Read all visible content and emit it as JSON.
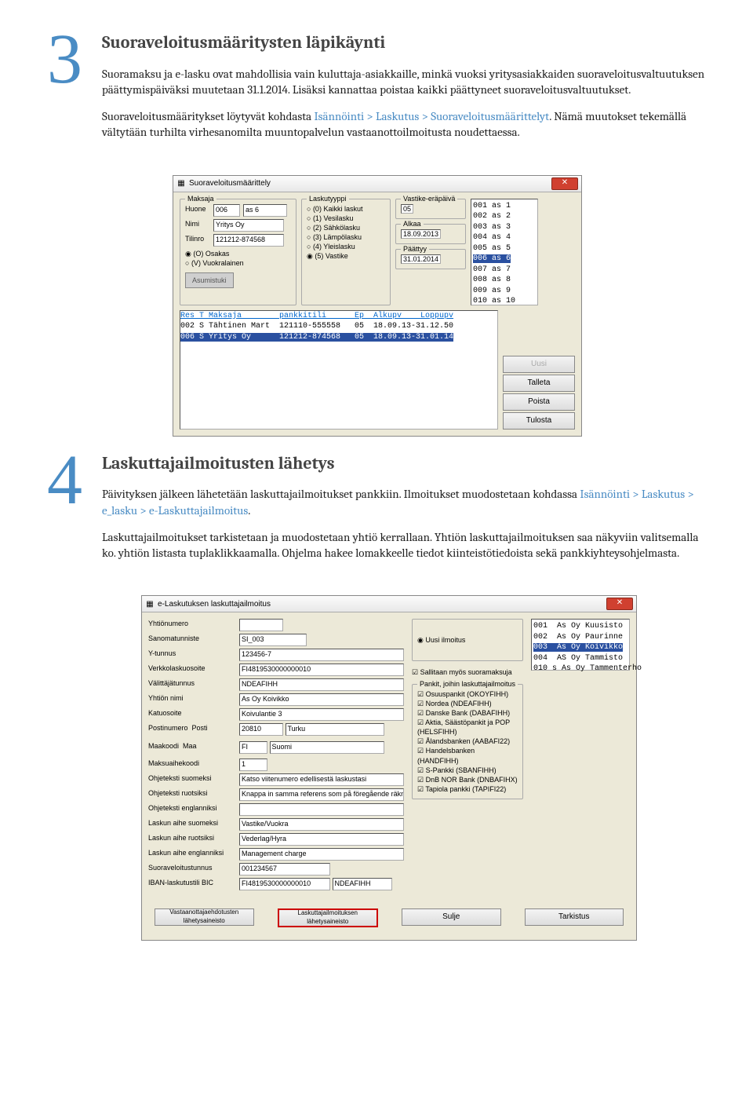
{
  "section3": {
    "num": "3",
    "title": "Suoraveloitusmääritysten läpikäynti",
    "para1": "Suoramaksu ja e-lasku ovat mahdollisia vain kuluttaja-asiakkaille, minkä vuoksi yritysasiakkaiden suoraveloitusvaltuutuksen päättymispäiväksi muutetaan 31.1.2014. Lisäksi kannattaa poistaa kaikki päättyneet suoraveloitusvaltuutukset.",
    "para2a": "Suoraveloitusmääritykset löytyvät kohdasta ",
    "para2link": "Isännöinti > Laskutus > Suoraveloitusmäärittelyt",
    "para2b": ". Nämä muutokset tekemällä vältytään turhilta virhesanomilta muuntopalvelun vastaanottoilmoitusta noudettaessa.",
    "win_title": "Suoraveloitusmäärittely",
    "left_labels": {
      "maksaja": "Maksaja",
      "huone": "Huone",
      "nimi": "Nimi",
      "tilinro": "Tilinro"
    },
    "left_vals": {
      "huone": "006",
      "huone_nimi": "as 6",
      "nimi": "Yritys Oy",
      "tilinro": "121212-874568"
    },
    "role_options": [
      "(O) Osakas",
      "(V) Vuokralainen"
    ],
    "role_selected": 0,
    "asumistuki_btn": "Asumistuki",
    "laskutyyppi_label": "Laskutyyppi",
    "laskutyypit": [
      "(0) Kaikki laskut",
      "(1) Vesilasku",
      "(2) Sähkölasku",
      "(3) Lämpölasku",
      "(4) Yleislasku",
      "(5) Vastike"
    ],
    "laskutyyppi_selected": 5,
    "mid_labels": {
      "era": "Vastike-eräpäivä",
      "alkaa": "Alkaa",
      "paattyy": "Päättyy"
    },
    "mid_vals": {
      "era": "05",
      "alkaa": "18.09.2013",
      "paattyy": "31.01.2014"
    },
    "side_list": [
      "001 as 1",
      "002 as 2",
      "003 as 3",
      "004 as 4",
      "005 as 5",
      "006 as 6",
      "007 as 7",
      "008 as 8",
      "009 as 9",
      "010 as 10"
    ],
    "side_selected_index": 5,
    "listing_header": "Res T Maksaja        pankkitili      Ep  Alkupv    Loppupv",
    "listing_rows": [
      "002 S Tähtinen Mart  121110-555558   05  18.09.13-31.12.50",
      "006 S Yritys Oy      121212-874568   05  18.09.13-31.01.14"
    ],
    "listing_selected_index": 1,
    "bottom_buttons": [
      "Uusi",
      "Talleta",
      "Poista",
      "Tulosta"
    ]
  },
  "section4": {
    "num": "4",
    "title": "Laskuttajailmoitusten lähetys",
    "para1a": "Päivityksen jälkeen lähetetään laskuttajailmoitukset pankkiin. Ilmoitukset muodostetaan kohdassa ",
    "para1link": "Isännöinti > Laskutus > e_lasku > e-Laskuttajailmoitus",
    "para1b": ".",
    "para2": "Laskuttajailmoitukset tarkistetaan ja muodostetaan yhtiö kerrallaan. Yhtiön laskuttajailmoituksen saa näkyviin valitsemalla ko. yhtiön listasta tuplaklikkaamalla. Ohjelma hakee lomakkeelle tiedot kiinteistötiedoista sekä pankkiyhteysohjelmasta.",
    "win_title": "e-Laskutuksen laskuttajailmoitus",
    "labels": {
      "yhtionumero": "Yhtiönumero",
      "sanomatunniste": "Sanomatunniste",
      "ytunnus": "Y-tunnus",
      "verkkolaskuosoite": "Verkkolaskuosoite",
      "valittajatunnus": "Välittäjätunnus",
      "yhtion_nimi": "Yhtiön nimi",
      "katuosoite": "Katuosoite",
      "postinumero": "Postinumero",
      "posti": "Posti",
      "maakoodi": "Maakoodi",
      "maa": "Maa",
      "maksuaihekoodi": "Maksuaihekoodi",
      "oht_fi": "Ohjeteksti suomeksi",
      "oht_sv": "Ohjeteksti ruotsiksi",
      "oht_en": "Ohjeteksti englanniksi",
      "aihe_fi": "Laskun aihe suomeksi",
      "aihe_sv": "Laskun aihe ruotsiksi",
      "aihe_en": "Laskun aihe englanniksi",
      "svtunnus": "Suoraveloitustunnus",
      "ibanbic": "IBAN-laskutustili   BIC"
    },
    "vals": {
      "yhtionumero": "",
      "sanomatunniste": "SI_003",
      "ytunnus": "123456-7",
      "verkkolaskuosoite": "FI4819530000000010",
      "valittajatunnus": "NDEAFIHH",
      "yhtion_nimi": "As Oy Koivikko",
      "katuosoite": "Koivulantie 3",
      "postinumero": "20810",
      "posti": "Turku",
      "maakoodi": "FI",
      "maa": "Suomi",
      "maksuaihekoodi": "1",
      "oht_fi": "Katso viitenumero edellisestä laskustasi",
      "oht_sv": "Knappa in samma referens som på föregående räkning",
      "oht_en": "",
      "aihe_fi": "Vastike/Vuokra",
      "aihe_sv": "Vederlag/Hyra",
      "aihe_en": "Management charge",
      "svtunnus": "001234567",
      "iban": "FI4819530000000010",
      "bic": "NDEAFIHH"
    },
    "ilmoitus_option": "Uusi ilmoitus",
    "sallitaan": "Sallitaan myös suoramaksuja",
    "pankit_label": "Pankit, joihin laskuttajailmoitus",
    "pankit": [
      "Osuuspankit (OKOYFIHH)",
      "Nordea (NDEAFIHH)",
      "Danske Bank (DABAFIHH)",
      "Aktia, Säästöpankit ja POP (HELSFIHH)",
      "Ålandsbanken (AABAFI22)",
      "Handelsbanken (HANDFIHH)",
      "S-Pankki (SBANFIHH)",
      "DnB NOR Bank (DNBAFIHX)",
      "Tapiola pankki   (TAPIFI22)"
    ],
    "side_list": [
      "001  As Oy Kuusisto",
      "002  As Oy Paurinne",
      "003  As Oy Koivikko",
      "004  AS Oy Tammisto",
      "010 s As Oy Tammenterho"
    ],
    "side_selected_index": 2,
    "footer": {
      "btn1": "Vastaanottajaehdotusten lähetysaineisto",
      "btn2": "Laskuttajailmoituksen lähetysaineisto",
      "btn3": "Sulje",
      "btn4": "Tarkistus"
    }
  }
}
